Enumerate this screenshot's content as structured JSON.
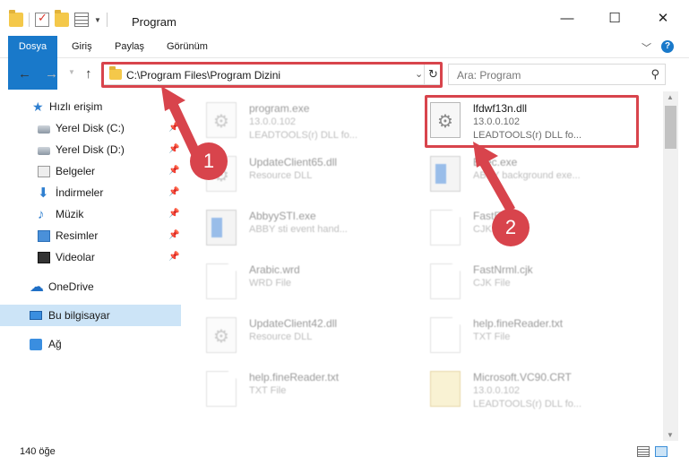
{
  "window": {
    "title": "Program",
    "minimize_glyph": "—",
    "maximize_glyph": "☐",
    "close_glyph": "✕"
  },
  "ribbon": {
    "tabs": [
      {
        "label": "Dosya"
      },
      {
        "label": "Giriş"
      },
      {
        "label": "Paylaş"
      },
      {
        "label": "Görünüm"
      }
    ],
    "help_glyph": "?"
  },
  "nav": {
    "back_glyph": "←",
    "forward_glyph": "→",
    "up_glyph": "↑",
    "address_path": "C:\\Program Files\\Program Dizini",
    "search_placeholder": "Ara: Program"
  },
  "sidebar": {
    "items": [
      {
        "label": "Hızlı erişim",
        "icon": "star-icon"
      },
      {
        "label": "Yerel Disk (C:)",
        "icon": "drive-icon",
        "pinned": true
      },
      {
        "label": "Yerel Disk (D:)",
        "icon": "drive-icon",
        "pinned": true
      },
      {
        "label": "Belgeler",
        "icon": "documents-icon",
        "pinned": true
      },
      {
        "label": "İndirmeler",
        "icon": "download-icon",
        "pinned": true
      },
      {
        "label": "Müzik",
        "icon": "music-icon",
        "pinned": true
      },
      {
        "label": "Resimler",
        "icon": "pictures-icon",
        "pinned": true
      },
      {
        "label": "Videolar",
        "icon": "videos-icon",
        "pinned": true
      },
      {
        "label": "OneDrive",
        "icon": "onedrive-icon"
      },
      {
        "label": "Bu bilgisayar",
        "icon": "this-pc-icon",
        "selected": true
      },
      {
        "label": "Ağ",
        "icon": "network-icon"
      }
    ]
  },
  "files": [
    {
      "name": "program.exe",
      "line2": "13.0.0.102",
      "line3": "LEADTOOLS(r) DLL fo...",
      "icon": "gear-doc-icon"
    },
    {
      "name": "lfdwf13n.dll",
      "line2": "13.0.0.102",
      "line3": "LEADTOOLS(r) DLL fo...",
      "icon": "dll-gear-icon",
      "highlighted": true
    },
    {
      "name": "UpdateClient65.dll",
      "line2": "Resource DLL",
      "line3": "",
      "icon": "dll-gear-icon"
    },
    {
      "name": "Exec.exe",
      "line2": "ABBY background exe...",
      "line3": "",
      "icon": "exe-window-icon"
    },
    {
      "name": "AbbyySTI.exe",
      "line2": "ABBY sti event hand...",
      "line3": "",
      "icon": "exe-window-icon"
    },
    {
      "name": "FastE...cjk",
      "line2": "CJK File",
      "line3": "",
      "icon": "blank-doc-icon"
    },
    {
      "name": "Arabic.wrd",
      "line2": "WRD File",
      "line3": "",
      "icon": "blank-doc-icon"
    },
    {
      "name": "FastNrml.cjk",
      "line2": "CJK File",
      "line3": "",
      "icon": "blank-doc-icon"
    },
    {
      "name": "UpdateClient42.dll",
      "line2": "Resource DLL",
      "line3": "",
      "icon": "dll-gear-icon"
    },
    {
      "name": "help.fineReader.txt",
      "line2": "TXT File",
      "line3": "",
      "icon": "blank-doc-icon"
    },
    {
      "name": "help.fineReader.txt",
      "line2": "TXT File",
      "line3": "",
      "icon": "blank-doc-icon"
    },
    {
      "name": "Microsoft.VC90.CRT",
      "line2": "13.0.0.102",
      "line3": "LEADTOOLS(r) DLL fo...",
      "icon": "manifest-icon"
    }
  ],
  "status": {
    "count": "140 öğe"
  },
  "annotations": {
    "badge1": "1",
    "badge2": "2"
  },
  "colors": {
    "accent": "#1979ca",
    "annotation_red": "#d8444c",
    "selected_bg": "#cce4f7"
  }
}
